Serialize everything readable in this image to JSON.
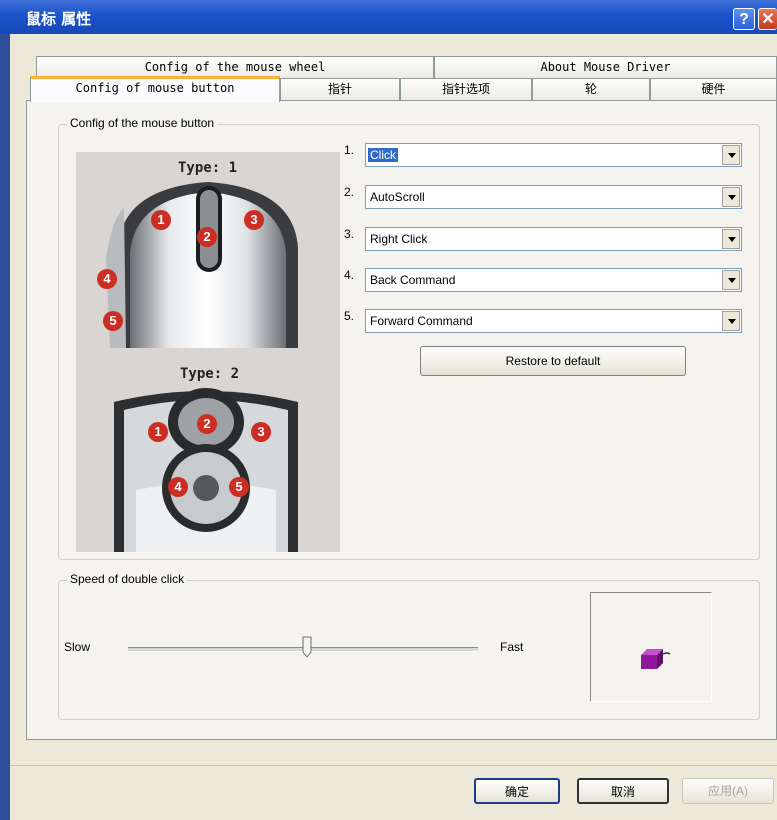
{
  "window": {
    "title": "鼠标 属性",
    "help_glyph": "?",
    "close_glyph": "✕"
  },
  "tabs": {
    "row_back": [
      "Config of the mouse wheel",
      "About Mouse Driver"
    ],
    "row_front": [
      "Config of mouse button",
      "指针",
      "指针选项",
      "轮",
      "硬件"
    ],
    "active": "Config of mouse button"
  },
  "button_group": {
    "label": "Config of the mouse button",
    "type1_label": "Type: 1",
    "type2_label": "Type: 2",
    "markers": [
      "1",
      "2",
      "3",
      "4",
      "5"
    ],
    "assignments": [
      {
        "num": "1.",
        "value": "Click",
        "selected": true
      },
      {
        "num": "2.",
        "value": "AutoScroll"
      },
      {
        "num": "3.",
        "value": "Right Click"
      },
      {
        "num": "4.",
        "value": "Back Command"
      },
      {
        "num": "5.",
        "value": "Forward Command"
      }
    ],
    "restore_label": "Restore to default"
  },
  "speed_group": {
    "label": "Speed of double click",
    "slow_label": "Slow",
    "fast_label": "Fast",
    "level_percent": 51,
    "preview_icon": "purple-box-icon"
  },
  "footer": {
    "ok_label": "确定",
    "cancel_label": "取消",
    "apply_label": "应用(A)"
  },
  "colors": {
    "title_bar": "#1a52c9",
    "active_tab_accent": "#f9b33a",
    "selection": "#316ac5",
    "marker": "#cc2e24"
  }
}
